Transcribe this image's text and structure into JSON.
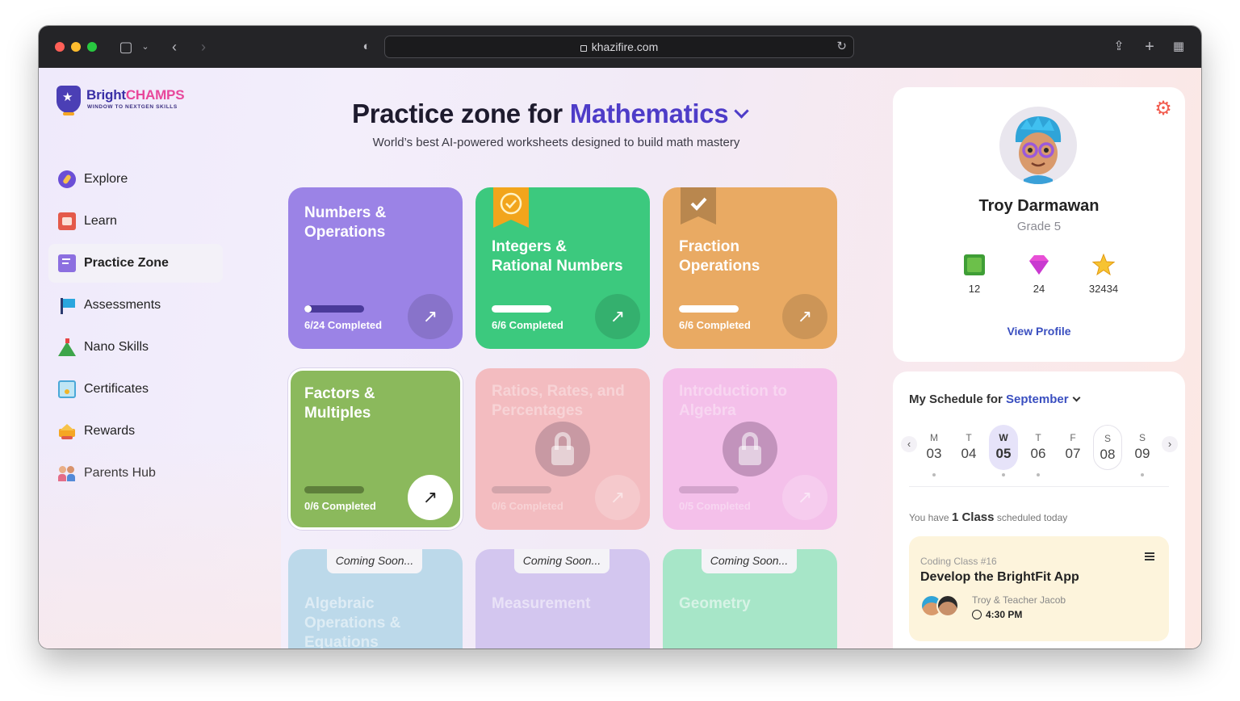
{
  "browser": {
    "url": "khazifire.com"
  },
  "brand": {
    "name_part1": "Bright",
    "name_part2": "CHAMPS",
    "tagline": "WINDOW TO NEXTGEN SKILLS"
  },
  "sidebar": {
    "items": [
      {
        "label": "Explore",
        "icon": "explore-compass-icon",
        "active": false
      },
      {
        "label": "Learn",
        "icon": "learn-book-icon",
        "active": false
      },
      {
        "label": "Practice Zone",
        "icon": "practice-worksheet-icon",
        "active": true
      },
      {
        "label": "Assessments",
        "icon": "assessments-flag-icon",
        "active": false
      },
      {
        "label": "Nano Skills",
        "icon": "nano-skills-mountain-icon",
        "active": false
      },
      {
        "label": "Certificates",
        "icon": "certificate-icon",
        "active": false
      },
      {
        "label": "Rewards",
        "icon": "rewards-crown-icon",
        "active": false
      },
      {
        "label": "Parents Hub",
        "icon": "parents-icon",
        "active": false
      }
    ]
  },
  "header": {
    "title_prefix": "Practice zone for",
    "subject": "Mathematics",
    "subtitle": "World’s best AI-powered worksheets designed to build math mastery"
  },
  "cards": [
    {
      "title_line1": "Numbers &",
      "title_line2": "Operations",
      "progress_text": "6/24 Completed",
      "progress": 0.25,
      "color": "#9b83e6",
      "state": "open"
    },
    {
      "title_line1": "Integers &",
      "title_line2": "Rational Numbers",
      "progress_text": "6/6 Completed",
      "progress": 1,
      "color": "#3cc97e",
      "state": "done-badge"
    },
    {
      "title_line1": "Fraction",
      "title_line2": "Operations",
      "progress_text": "6/6 Completed",
      "progress": 1,
      "color": "#e9aa63",
      "state": "done-check"
    },
    {
      "title_line1": "Factors &",
      "title_line2": "Multiples",
      "progress_text": "0/6 Completed",
      "progress": 0,
      "color": "#8bb95c",
      "state": "selected"
    },
    {
      "title_line1": "Ratios, Rates, and",
      "title_line2": "Percentages",
      "progress_text": "0/6 Completed",
      "progress": 0,
      "color": "#f3bcc0",
      "state": "locked"
    },
    {
      "title_line1": "Introduction to",
      "title_line2": "Algebra",
      "progress_text": "0/5 Completed",
      "progress": 0,
      "color": "#f4c0ea",
      "state": "locked"
    },
    {
      "title_line1": "Algebraic",
      "title_line2": "Operations &",
      "title_line3": "Equations",
      "tag": "Coming Soon...",
      "color": "#bcd9ea",
      "state": "coming-soon"
    },
    {
      "title_line1": "Measurement",
      "tag": "Coming Soon...",
      "color": "#d3c6ef",
      "state": "coming-soon"
    },
    {
      "title_line1": "Geometry",
      "tag": "Coming Soon...",
      "color": "#a7e6c8",
      "state": "coming-soon"
    }
  ],
  "profile": {
    "name": "Troy Darmawan",
    "grade": "Grade 5",
    "stats": [
      {
        "icon": "green-gem-icon",
        "value": "12"
      },
      {
        "icon": "pink-diamond-icon",
        "value": "24"
      },
      {
        "icon": "star-icon",
        "value": "32434"
      }
    ],
    "view_profile": "View Profile"
  },
  "schedule": {
    "title_prefix": "My Schedule for",
    "month": "September",
    "days": [
      {
        "letter": "M",
        "num": "03",
        "dot": true
      },
      {
        "letter": "T",
        "num": "04",
        "dot": false
      },
      {
        "letter": "W",
        "num": "05",
        "dot": true,
        "selected": true
      },
      {
        "letter": "T",
        "num": "06",
        "dot": true
      },
      {
        "letter": "F",
        "num": "07",
        "dot": false
      },
      {
        "letter": "S",
        "num": "08",
        "dot": false,
        "today": true
      },
      {
        "letter": "S",
        "num": "09",
        "dot": true
      }
    ],
    "note_prefix": "You have",
    "note_count": "1 Class",
    "note_suffix": "scheduled today",
    "class": {
      "label": "Coding Class #16",
      "title": "Develop the BrightFit App",
      "who": "Troy & Teacher Jacob",
      "time": "4:30 PM"
    }
  }
}
